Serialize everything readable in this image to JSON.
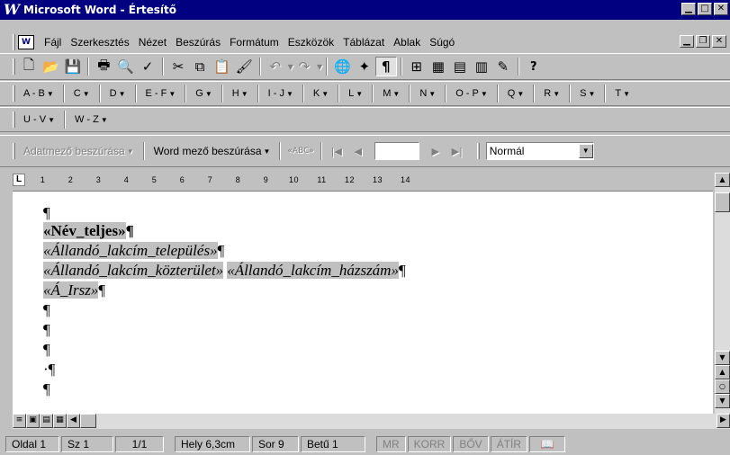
{
  "window": {
    "title": "Microsoft Word - Értesítő",
    "app_icon": "W",
    "cap_minimize": "▁",
    "cap_restore": "□",
    "cap_close": "✕"
  },
  "menu": {
    "doc_icon": "W",
    "items": [
      "Fájl",
      "Szerkesztés",
      "Nézet",
      "Beszúrás",
      "Formátum",
      "Eszközök",
      "Táblázat",
      "Ablak",
      "Súgó"
    ],
    "mdi_minimize": "▁",
    "mdi_restore": "❐",
    "mdi_close": "✕"
  },
  "toolbar_standard": {
    "icons": [
      "new-icon",
      "open-icon",
      "save-icon",
      "print-icon",
      "print-preview-icon",
      "spelling-icon",
      "cut-icon",
      "copy-icon",
      "paste-icon",
      "format-painter-icon",
      "undo-icon",
      "redo-icon",
      "hyperlink-icon",
      "web-toolbar-icon",
      "show-hide-icon",
      "tables-borders-icon",
      "insert-table-icon",
      "insert-excel-icon",
      "columns-icon",
      "drawing-icon",
      "help-icon"
    ],
    "glyphs": {
      "new": "🗋",
      "open": "📂",
      "save": "💾",
      "print": "🖶",
      "preview": "🔍",
      "spell": "✓",
      "cut": "✂",
      "copy": "⧉",
      "paste": "📋",
      "painter": "🖌",
      "undo": "↶",
      "redo": "↷",
      "hyperlink": "🌐",
      "web": "✦",
      "pilcrow": "¶",
      "tables": "⊞",
      "table": "▦",
      "excel": "▤",
      "columns": "▥",
      "drawing": "✎",
      "help": "?"
    }
  },
  "toolbar_alpha": {
    "row1": [
      "A - B",
      "C",
      "D",
      "E - F",
      "G",
      "H",
      "I - J",
      "K",
      "L",
      "M",
      "N",
      "O - P",
      "Q",
      "R",
      "S",
      "T"
    ],
    "row2": [
      "U - V",
      "W - Z"
    ]
  },
  "toolbar_merge": {
    "insert_merge_field": "Adatmező beszúrása",
    "insert_word_field": "Word mező beszúrása",
    "view_merged": "«ABC»",
    "nav_first": "|◀",
    "nav_prev": "◀",
    "nav_next": "▶",
    "nav_last": "▶|",
    "record_value": "",
    "style_value": "Normál"
  },
  "ruler": {
    "tab_marker": "L",
    "numbers": [
      "1",
      "2",
      "3",
      "4",
      "5",
      "6",
      "7",
      "8",
      "9",
      "10",
      "11",
      "12",
      "13",
      "14"
    ]
  },
  "document": {
    "pilcrow": "¶",
    "field_nev_teljes": "«Név_teljes»",
    "field_telepules": "«Állandó_lakcím_település»",
    "field_kozterulet": "«Állandó_lakcím_közterület»",
    "field_hazszam": "«Állandó_lakcím_házszám»",
    "field_irsz": "«Á_Irsz»",
    "dotted_pilcrow": "·¶"
  },
  "status": {
    "page": "Oldal 1",
    "section": "Sz 1",
    "pages": "1/1",
    "position": "Hely 6,3cm",
    "line": "Sor 9",
    "column": "Betű 1",
    "rec": "MR",
    "trk": "KORR",
    "ext": "BŐV",
    "ovr": "ÁTÍR"
  }
}
